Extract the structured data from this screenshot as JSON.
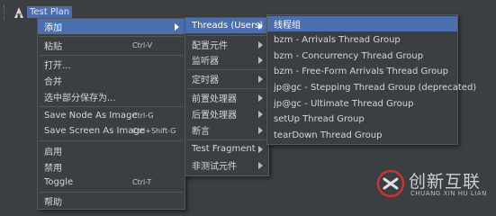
{
  "tree": {
    "root_label": "Test Plan",
    "root_icon": "test-plan-icon"
  },
  "context_menu": [
    {
      "label": "添加",
      "shortcut": "",
      "submenu": true,
      "active": true
    },
    {
      "label": "粘贴",
      "shortcut": "Ctrl-V"
    },
    {
      "label": "打开..."
    },
    {
      "label": "合并"
    },
    {
      "label": "选中部分保存为..."
    },
    {
      "label": "Save Node As Image",
      "shortcut": "Ctrl-G"
    },
    {
      "label": "Save Screen As Image",
      "shortcut": "Ctrl+Shift-G"
    },
    {
      "label": "启用"
    },
    {
      "label": "禁用"
    },
    {
      "label": "Toggle",
      "shortcut": "Ctrl-T"
    },
    {
      "label": "帮助"
    }
  ],
  "add_submenu": [
    {
      "label": "Threads (Users)",
      "submenu": true,
      "active": true
    },
    {
      "label": "配置元件",
      "submenu": true
    },
    {
      "label": "监听器",
      "submenu": true
    },
    {
      "label": "定时器",
      "submenu": true
    },
    {
      "label": "前置处理器",
      "submenu": true
    },
    {
      "label": "后置处理器",
      "submenu": true
    },
    {
      "label": "断言",
      "submenu": true
    },
    {
      "label": "Test Fragment",
      "submenu": true
    },
    {
      "label": "非测试元件",
      "submenu": true
    }
  ],
  "threads_submenu": [
    {
      "label": "线程组",
      "active": true
    },
    {
      "label": "bzm - Arrivals Thread Group"
    },
    {
      "label": "bzm - Concurrency Thread Group"
    },
    {
      "label": "bzm - Free-Form Arrivals Thread Group"
    },
    {
      "label": "jp@gc - Stepping Thread Group (deprecated)"
    },
    {
      "label": "jp@gc - Ultimate Thread Group"
    },
    {
      "label": "setUp Thread Group"
    },
    {
      "label": "tearDown Thread Group"
    }
  ],
  "watermark": {
    "cn": "创新互联",
    "en": "CHUANG XIN HU LIAN"
  },
  "colors": {
    "background": "#3c3f41",
    "highlight": "#4b6eaf",
    "text": "#d6d6d6",
    "watermark_logo": "#cc3333"
  }
}
